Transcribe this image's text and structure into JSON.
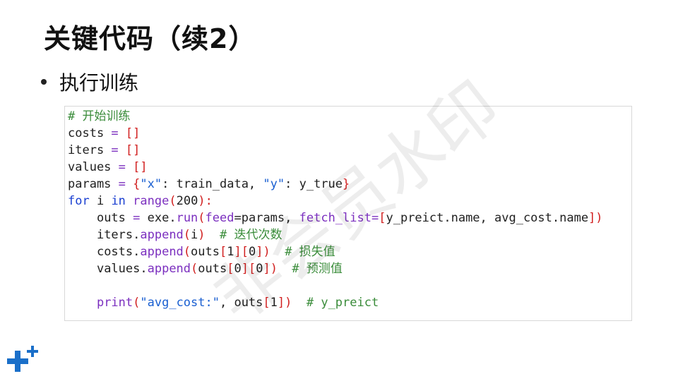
{
  "slide": {
    "title": "关键代码（续2）",
    "bullet": "执行训练",
    "watermark": "非会员水印",
    "logo_icon": "medical-plus-logo"
  },
  "code": {
    "lines": [
      {
        "indent": "",
        "parts": [
          {
            "t": "# 开始训练",
            "c": "comment"
          }
        ]
      },
      {
        "indent": "",
        "parts": [
          {
            "t": "costs ",
            "c": ""
          },
          {
            "t": "= ",
            "c": "kw"
          },
          {
            "t": "[]",
            "c": "punc"
          }
        ]
      },
      {
        "indent": "",
        "parts": [
          {
            "t": "iters ",
            "c": ""
          },
          {
            "t": "= ",
            "c": "kw"
          },
          {
            "t": "[]",
            "c": "punc"
          }
        ]
      },
      {
        "indent": "",
        "parts": [
          {
            "t": "values ",
            "c": ""
          },
          {
            "t": "= ",
            "c": "kw"
          },
          {
            "t": "[]",
            "c": "punc"
          }
        ]
      },
      {
        "indent": "",
        "parts": [
          {
            "t": "params ",
            "c": ""
          },
          {
            "t": "= ",
            "c": "kw"
          },
          {
            "t": "{",
            "c": "punc"
          },
          {
            "t": "\"x\"",
            "c": "str"
          },
          {
            "t": ": train_data, ",
            "c": ""
          },
          {
            "t": "\"y\"",
            "c": "str"
          },
          {
            "t": ": y_true",
            "c": ""
          },
          {
            "t": "}",
            "c": "punc"
          }
        ]
      },
      {
        "indent": "",
        "parts": [
          {
            "t": "for",
            "c": "kwblue"
          },
          {
            "t": " i ",
            "c": ""
          },
          {
            "t": "in",
            "c": "kwblue"
          },
          {
            "t": " ",
            "c": ""
          },
          {
            "t": "range",
            "c": "kw"
          },
          {
            "t": "(",
            "c": "punc"
          },
          {
            "t": "200",
            "c": ""
          },
          {
            "t": "):",
            "c": "punc"
          }
        ]
      },
      {
        "indent": "    ",
        "parts": [
          {
            "t": "outs ",
            "c": ""
          },
          {
            "t": "= ",
            "c": "kw"
          },
          {
            "t": "exe.",
            "c": ""
          },
          {
            "t": "run",
            "c": "kw"
          },
          {
            "t": "(",
            "c": "punc"
          },
          {
            "t": "feed",
            "c": "kw"
          },
          {
            "t": "=params, ",
            "c": ""
          },
          {
            "t": "fetch_list",
            "c": "kw"
          },
          {
            "t": "=",
            "c": "kw"
          },
          {
            "t": "[",
            "c": "punc"
          },
          {
            "t": "y_preict.name, avg_cost.name",
            "c": ""
          },
          {
            "t": "])",
            "c": "punc"
          }
        ]
      },
      {
        "indent": "    ",
        "parts": [
          {
            "t": "iters.",
            "c": ""
          },
          {
            "t": "append",
            "c": "kw"
          },
          {
            "t": "(",
            "c": "punc"
          },
          {
            "t": "i",
            "c": ""
          },
          {
            "t": ")",
            "c": "punc"
          },
          {
            "t": "  # 迭代次数",
            "c": "comment"
          }
        ]
      },
      {
        "indent": "    ",
        "parts": [
          {
            "t": "costs.",
            "c": ""
          },
          {
            "t": "append",
            "c": "kw"
          },
          {
            "t": "(",
            "c": "punc"
          },
          {
            "t": "outs",
            "c": ""
          },
          {
            "t": "[",
            "c": "punc"
          },
          {
            "t": "1",
            "c": ""
          },
          {
            "t": "][",
            "c": "punc"
          },
          {
            "t": "0",
            "c": ""
          },
          {
            "t": "])",
            "c": "punc"
          },
          {
            "t": "  # 损失值",
            "c": "comment"
          }
        ]
      },
      {
        "indent": "    ",
        "parts": [
          {
            "t": "values.",
            "c": ""
          },
          {
            "t": "append",
            "c": "kw"
          },
          {
            "t": "(",
            "c": "punc"
          },
          {
            "t": "outs",
            "c": ""
          },
          {
            "t": "[",
            "c": "punc"
          },
          {
            "t": "0",
            "c": ""
          },
          {
            "t": "][",
            "c": "punc"
          },
          {
            "t": "0",
            "c": ""
          },
          {
            "t": "])",
            "c": "punc"
          },
          {
            "t": "  # 预测值",
            "c": "comment"
          }
        ]
      },
      {
        "indent": "",
        "parts": [
          {
            "t": "",
            "c": ""
          }
        ]
      },
      {
        "indent": "    ",
        "parts": [
          {
            "t": "print",
            "c": "kw"
          },
          {
            "t": "(",
            "c": "punc"
          },
          {
            "t": "\"avg_cost:\"",
            "c": "str"
          },
          {
            "t": ", outs",
            "c": ""
          },
          {
            "t": "[",
            "c": "punc"
          },
          {
            "t": "1",
            "c": ""
          },
          {
            "t": "])",
            "c": "punc"
          },
          {
            "t": "  # y_preict",
            "c": "comment"
          }
        ]
      }
    ]
  }
}
